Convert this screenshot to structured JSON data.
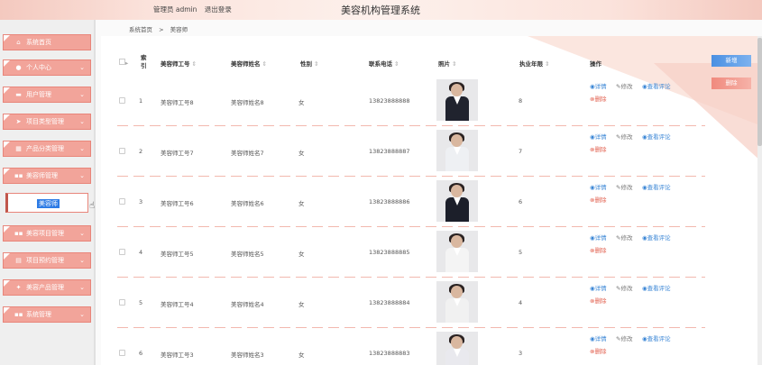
{
  "header": {
    "title": "美容机构管理系统",
    "user_label": "管理员 admin",
    "logout_label": "退出登录"
  },
  "sidebar": {
    "items": [
      {
        "label": "系统首页",
        "icon": "home-icon",
        "glyph": "⌂",
        "has_chevron": false
      },
      {
        "label": "个人中心",
        "icon": "user-icon",
        "glyph": "●",
        "has_chevron": true
      },
      {
        "label": "用户管理",
        "icon": "briefcase-icon",
        "glyph": "▬",
        "has_chevron": true
      },
      {
        "label": "项目类型管理",
        "icon": "send-icon",
        "glyph": "➤",
        "has_chevron": true
      },
      {
        "label": "产品分类管理",
        "icon": "calendar-icon",
        "glyph": "▦",
        "has_chevron": true
      },
      {
        "label": "美容师管理",
        "icon": "grid-icon",
        "glyph": "▪▪",
        "has_chevron": true
      },
      {
        "label": "美容项目管理",
        "icon": "grid-icon",
        "glyph": "▪▪",
        "has_chevron": true
      },
      {
        "label": "项目预约管理",
        "icon": "table-icon",
        "glyph": "▤",
        "has_chevron": true
      },
      {
        "label": "美容产品管理",
        "icon": "bulb-icon",
        "glyph": "✦",
        "has_chevron": true
      },
      {
        "label": "系统管理",
        "icon": "grid-icon",
        "glyph": "▪▪",
        "has_chevron": true
      }
    ],
    "submenu_selected": "美容师"
  },
  "breadcrumb": {
    "home": "系统首页",
    "separator": ">",
    "current": "美容师"
  },
  "actions": {
    "add_label": "新增",
    "delete_label": "删除"
  },
  "table": {
    "headers": {
      "index": "索引",
      "id": "美容师工号",
      "name": "美容师姓名",
      "gender": "性别",
      "phone": "联系电话",
      "photo": "照片",
      "years": "执业年限",
      "ops": "操作"
    },
    "sort_glyph": "⇕",
    "op_labels": {
      "detail": "详情",
      "edit": "修改",
      "review": "查看评论",
      "delete": "删除"
    },
    "rows": [
      {
        "index": "1",
        "id": "美容师工号8",
        "name": "美容师姓名8",
        "gender": "女",
        "phone": "13823888888",
        "years": "8"
      },
      {
        "index": "2",
        "id": "美容师工号7",
        "name": "美容师姓名7",
        "gender": "女",
        "phone": "13823888887",
        "years": "7"
      },
      {
        "index": "3",
        "id": "美容师工号6",
        "name": "美容师姓名6",
        "gender": "女",
        "phone": "13823888886",
        "years": "6"
      },
      {
        "index": "4",
        "id": "美容师工号5",
        "name": "美容师姓名5",
        "gender": "女",
        "phone": "13823888885",
        "years": "5"
      },
      {
        "index": "5",
        "id": "美容师工号4",
        "name": "美容师姓名4",
        "gender": "女",
        "phone": "13823888884",
        "years": "4"
      },
      {
        "index": "6",
        "id": "美容师工号3",
        "name": "美容师姓名3",
        "gender": "女",
        "phone": "13823888883",
        "years": "3"
      }
    ]
  },
  "colors": {
    "menu_bg": "#f2a49a",
    "accent_blue": "#3a86d6",
    "accent_red": "#e2604f"
  }
}
